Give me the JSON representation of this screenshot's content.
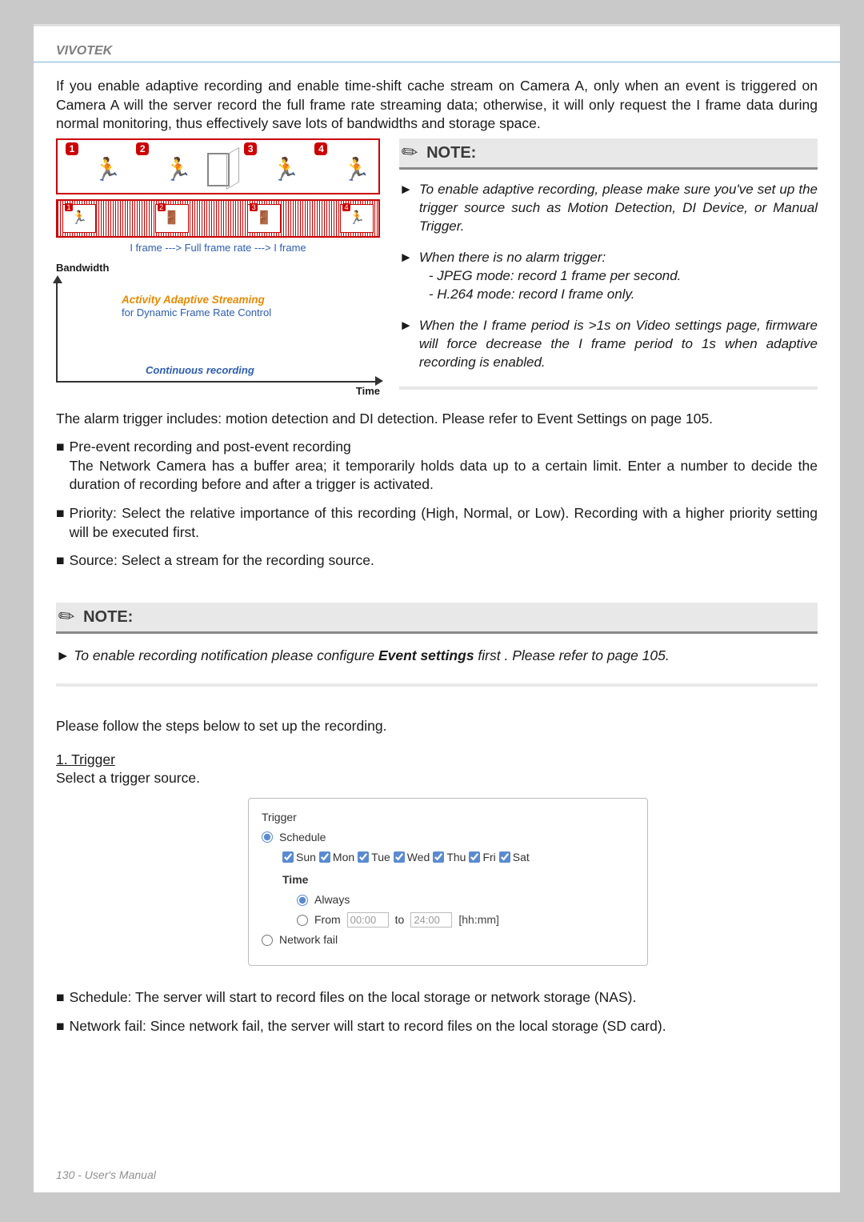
{
  "brand": "VIVOTEK",
  "intro": "If you enable adaptive recording and enable time-shift cache stream on Camera A, only when an event is triggered on Camera A will the server record the full frame rate streaming data; otherwise, it will only request the I frame data during normal monitoring, thus effectively save lots of bandwidths and storage space.",
  "diagram": {
    "iframe_label": "I frame   --->   Full frame rate   --->   I frame",
    "bandwidth": "Bandwidth",
    "aas": "Activity Adaptive Streaming",
    "dfrc": "for Dynamic Frame Rate Control",
    "cr": "Continuous recording",
    "time": "Time"
  },
  "note1": {
    "title": "NOTE:",
    "item1": "To enable adaptive recording, please make sure you've set up the trigger source such as Motion Detection, DI Device, or Manual Trigger.",
    "item2_lead": "When there is no alarm trigger:",
    "item2_a": "- JPEG mode: record 1 frame per second.",
    "item2_b": "- H.264 mode: record I frame only.",
    "item3": "When the I frame period is >1s on Video settings page, firmware will force decrease the I frame period to 1s when adaptive recording is enabled."
  },
  "alarm_text": "The alarm trigger includes: motion detection and DI detection. Please refer to Event Settings on page 105.",
  "bullets": {
    "b1_head": "Pre-event recording and post-event recording",
    "b1_body": "The Network Camera has a buffer area; it temporarily holds data up to a certain limit. Enter a number to decide the duration of recording before and after a trigger is activated.",
    "b2": "Priority: Select the relative importance of this recording (High, Normal, or Low). Recording with a higher priority setting will be executed first.",
    "b3": "Source: Select a stream for the recording source."
  },
  "note2": {
    "title": "NOTE:",
    "text_pre": "To enable recording notification please configure ",
    "text_bold": "Event settings",
    "text_post": " first . Please refer to page 105."
  },
  "steps_intro": "Please follow the steps below to set up the recording.",
  "step1": {
    "head": "1. Trigger",
    "sub": "Select a trigger source."
  },
  "trigger": {
    "legend": "Trigger",
    "schedule": "Schedule",
    "days": {
      "sun": "Sun",
      "mon": "Mon",
      "tue": "Tue",
      "wed": "Wed",
      "thu": "Thu",
      "fri": "Fri",
      "sat": "Sat"
    },
    "time": "Time",
    "always": "Always",
    "from": "From",
    "from_val": "00:00",
    "to": "to",
    "to_val": "24:00",
    "hint": "[hh:mm]",
    "network_fail": "Network fail"
  },
  "post_bullets": {
    "b1": "Schedule: The server will start to record files on the local storage or network storage (NAS).",
    "b2": "Network fail: Since network fail, the server will start to record files on the local storage (SD card)."
  },
  "footer": "130 - User's Manual"
}
